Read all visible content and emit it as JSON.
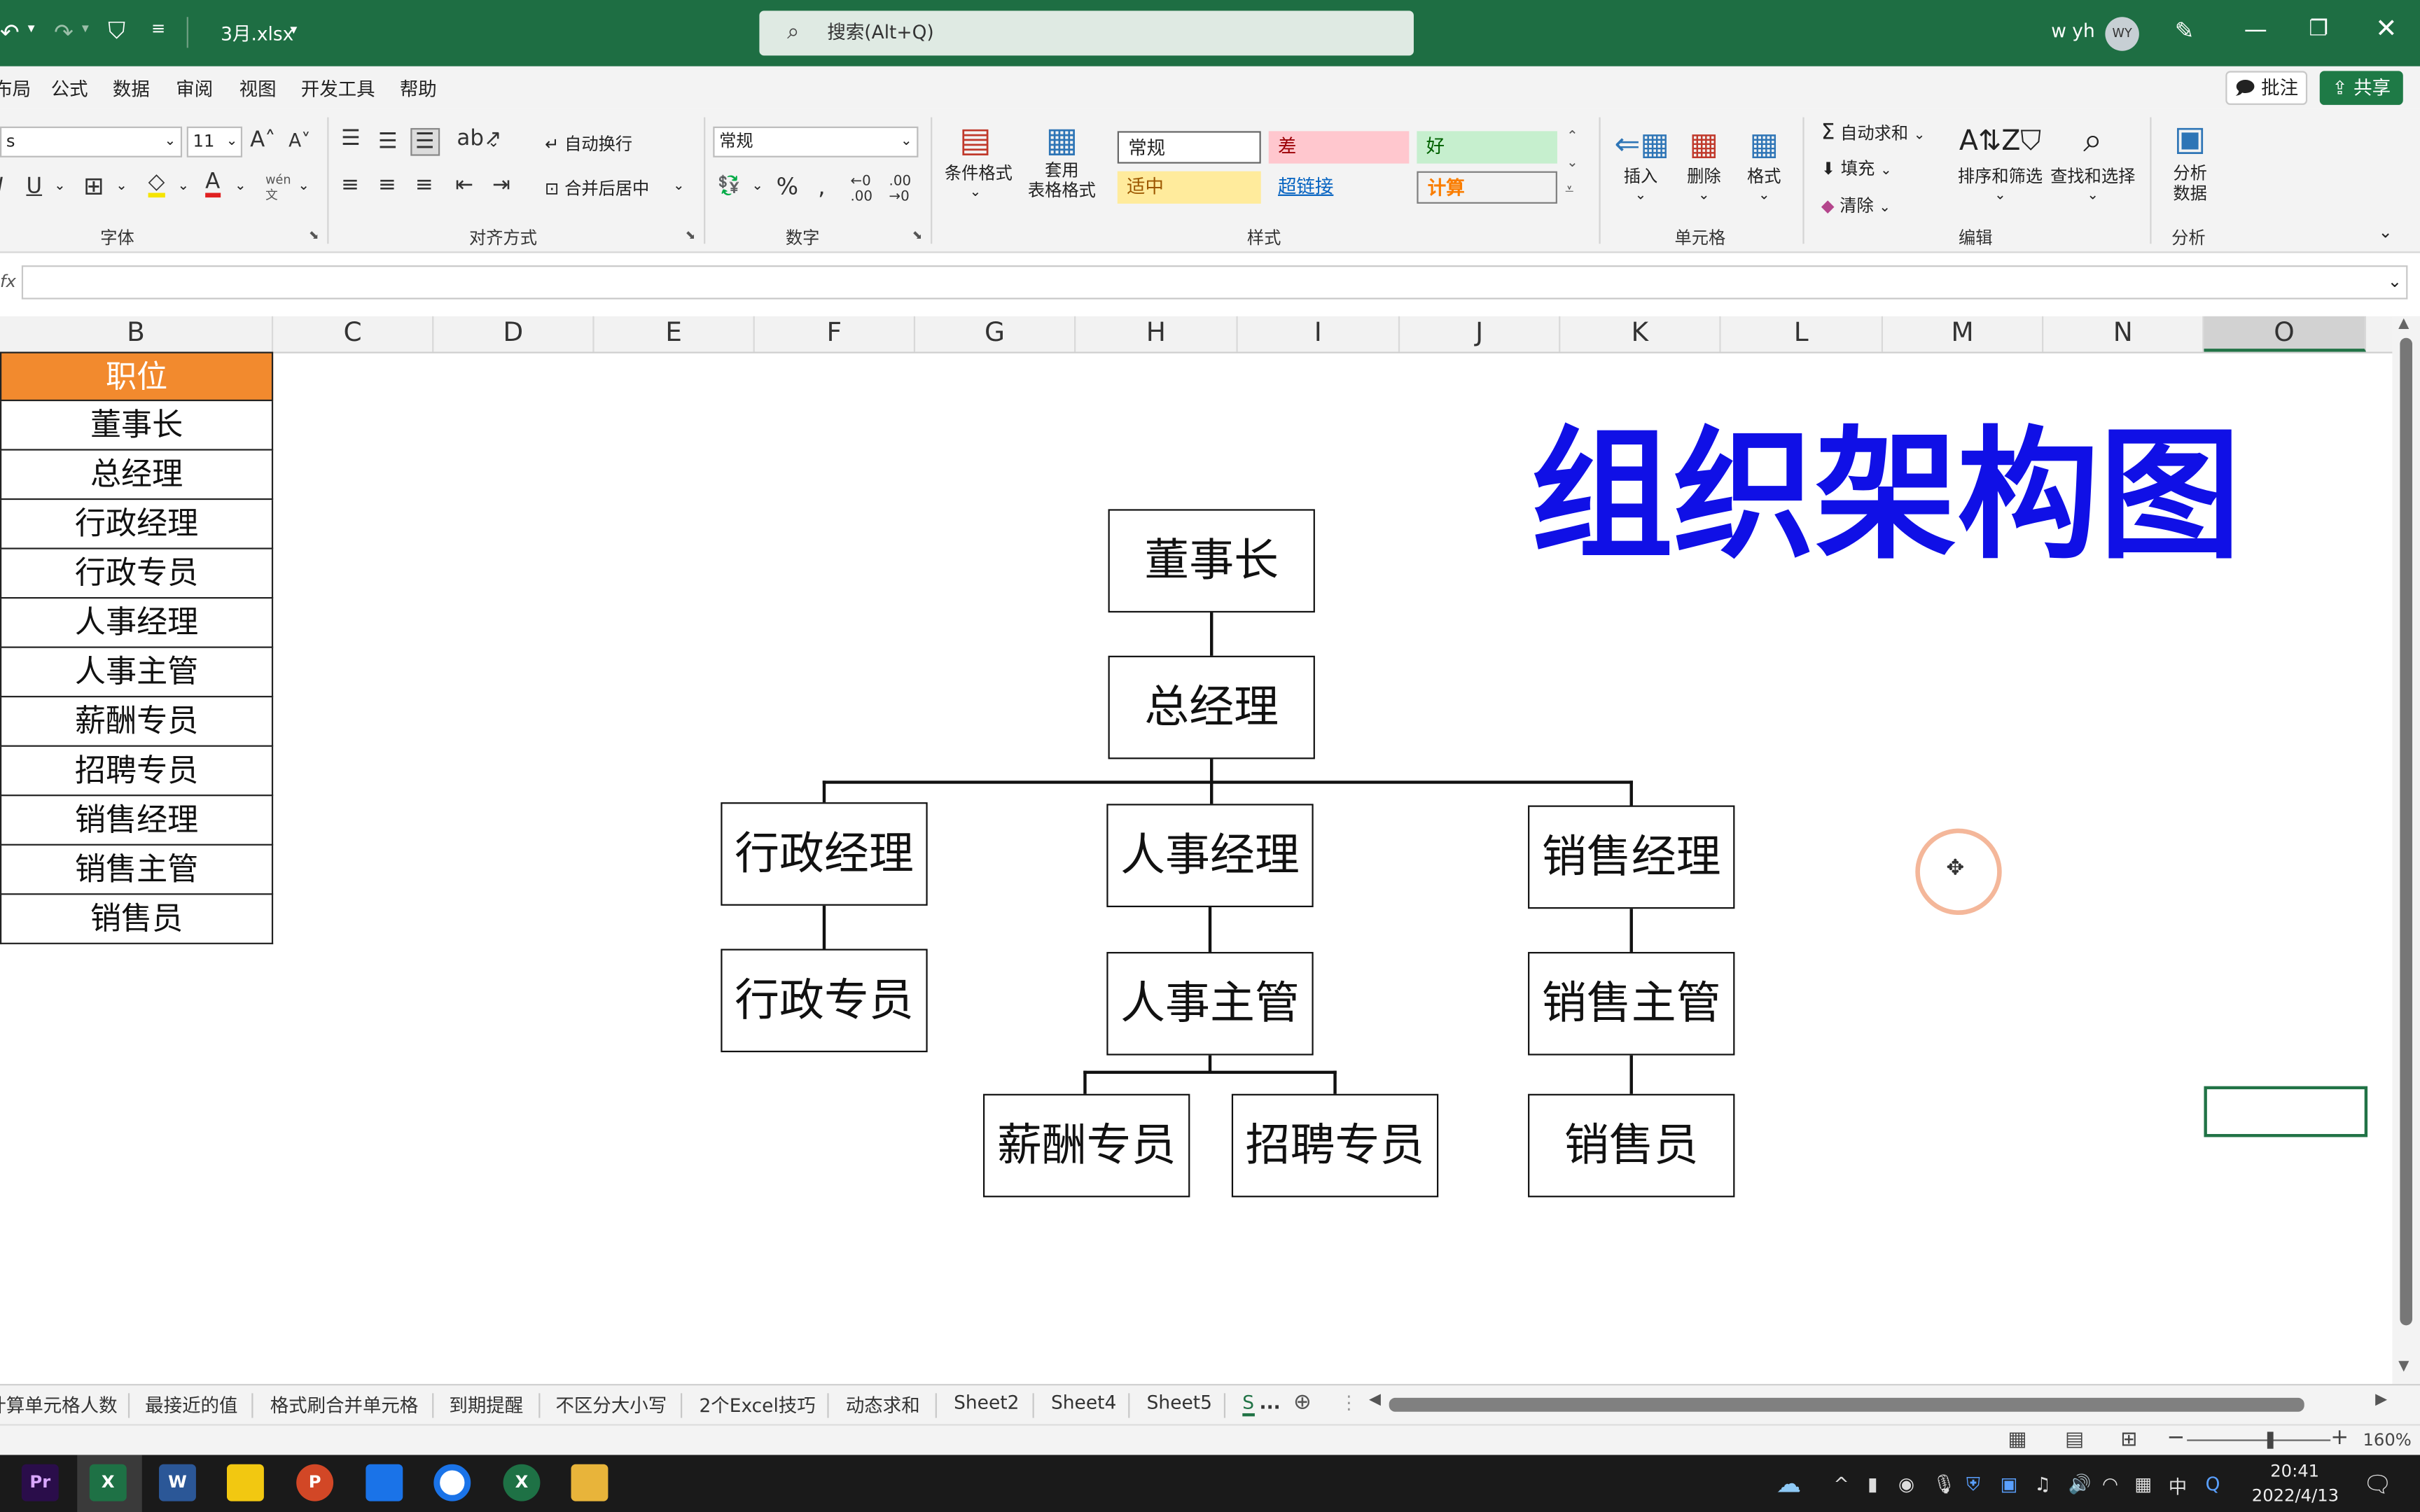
{
  "titlebar": {
    "filename": "3月.xlsx",
    "search_placeholder": "搜索(Alt+Q)",
    "user_name": "w yh",
    "user_initials": "WY"
  },
  "menu": {
    "items": [
      "布局",
      "公式",
      "数据",
      "审阅",
      "视图",
      "开发工具",
      "帮助"
    ],
    "comment_button": "批注",
    "share_button": "共享"
  },
  "ribbon": {
    "font_name": "s",
    "font_size": "11",
    "number_format": "常规",
    "wrap_text": "自动换行",
    "merge_center": "合并后居中",
    "conditional_format": "条件格式",
    "table_format_1": "套用",
    "table_format_2": "表格格式",
    "styles": {
      "normal": "常规",
      "bad": "差",
      "good": "好",
      "neutral": "适中",
      "hyperlink": "超链接",
      "calc": "计算"
    },
    "insert": "插入",
    "delete": "删除",
    "format": "格式",
    "autosum": "自动求和",
    "fill": "填充",
    "clear": "清除",
    "sort_filter": "排序和筛选",
    "find_select": "查找和选择",
    "analyze_1": "分析",
    "analyze_2": "数据",
    "groups": {
      "font": "字体",
      "align": "对齐方式",
      "number": "数字",
      "styles": "样式",
      "cells": "单元格",
      "edit": "编辑",
      "analyze": "分析"
    }
  },
  "formula": {
    "fx": "fx",
    "value": ""
  },
  "columns": [
    "B",
    "C",
    "D",
    "E",
    "F",
    "G",
    "H",
    "I",
    "J",
    "K",
    "L",
    "M",
    "N",
    "O"
  ],
  "table": {
    "header": "职位",
    "rows": [
      "董事长",
      "总经理",
      "行政经理",
      "行政专员",
      "人事经理",
      "人事主管",
      "薪酬专员",
      "招聘专员",
      "销售经理",
      "销售主管",
      "销售员"
    ]
  },
  "chart_title": "组织架构图",
  "org": {
    "n1": "董事长",
    "n2": "总经理",
    "n3": "行政经理",
    "n4": "人事经理",
    "n5": "销售经理",
    "n6": "行政专员",
    "n7": "人事主管",
    "n8": "销售主管",
    "n9": "薪酬专员",
    "n10": "招聘专员",
    "n11": "销售员"
  },
  "tabs": [
    "计算单元格人数",
    "最接近的值",
    "格式刷合并单元格",
    "到期提醒",
    "不区分大小写",
    "2个Excel技巧",
    "动态求和",
    "Sheet2",
    "Sheet4",
    "Sheet5",
    "S",
    "..."
  ],
  "status": {
    "zoom": "160%"
  },
  "taskbar": {
    "apps": [
      "Pr",
      "X",
      "W",
      "",
      "P",
      "",
      "",
      "X",
      ""
    ],
    "ime": "中",
    "time": "20:41",
    "date": "2022/4/13"
  },
  "colors": {
    "title_bg": "#1e6e43",
    "header_orange": "#f28a2e",
    "chart_title_blue": "#1010e6",
    "share_green": "#1e7a46"
  }
}
